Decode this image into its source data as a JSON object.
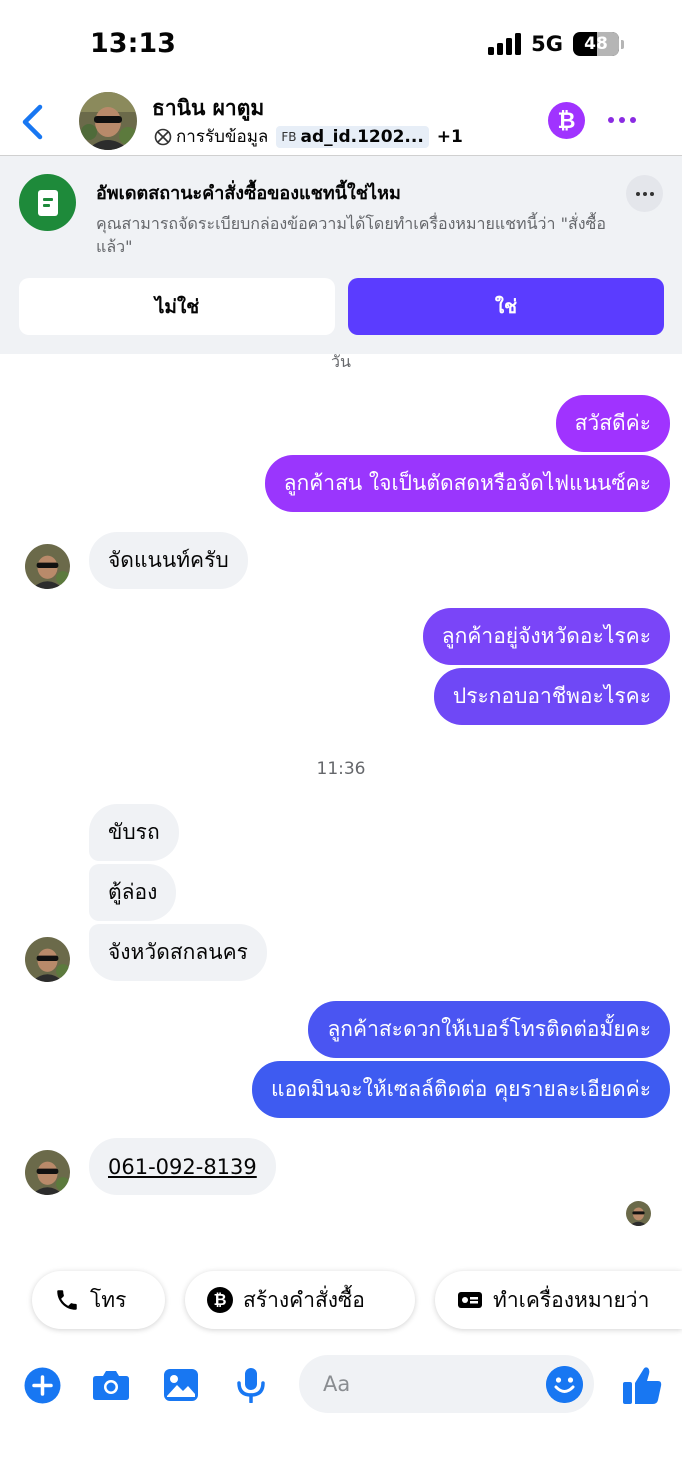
{
  "status_bar": {
    "time": "13:13",
    "network": "5G",
    "battery": "48"
  },
  "header": {
    "name": "ธานิน ผาตูม",
    "consent": "การรับข้อมูล",
    "ad_tag_prefix": "FB",
    "ad_tag": "ad_id.1202...",
    "extra_count": "+1",
    "bitcoin_glyph": "₿",
    "colors": {
      "accent": "#a033ff",
      "back": "#1877f2"
    }
  },
  "banner": {
    "title": "อัพเดตสถานะคำสั่งซื้อของแชทนี้ใช่ไหม",
    "description": "คุณสามารถจัดระเบียบกล่องข้อความได้โดยทำเครื่องหมายแชทนี้ว่า \"สั่งซื้อแล้ว\"",
    "no_label": "ไม่ใช่",
    "yes_label": "ใช่"
  },
  "chat": {
    "cut_divider": "วัน",
    "time_divider": "11:36",
    "messages": [
      {
        "dir": "out",
        "text": "สวัสดีค่ะ"
      },
      {
        "dir": "out",
        "text": "ลูกค้าสน ใจเป็นตัดสดหรือจัดไฟแนนซ์คะ"
      },
      {
        "dir": "in",
        "text": "จัดแนนท์ครับ"
      },
      {
        "dir": "out",
        "text": "ลูกค้าอยู่จังหวัดอะไรคะ"
      },
      {
        "dir": "out",
        "text": "ประกอบอาชีพอะไรคะ"
      },
      {
        "dir": "in",
        "text": "ขับรถ"
      },
      {
        "dir": "in",
        "text": "ตู้ล่อง"
      },
      {
        "dir": "in",
        "text": "จังหวัดสกลนคร"
      },
      {
        "dir": "out",
        "text": "ลูกค้าสะดวกให้เบอร์โทรติดต่อมั้ยคะ"
      },
      {
        "dir": "out",
        "text": "แอดมินจะให้เซลล์ติดต่อ คุยรายละเอียดค่ะ"
      },
      {
        "dir": "in",
        "text": "061-092-8139"
      }
    ],
    "bubble_colors": [
      "#a033ff",
      "#9a36fd",
      "#7a45f8",
      "#6f48f6",
      "#7045f7",
      "#4a55f2",
      "#3e5bf1"
    ]
  },
  "quick_actions": [
    {
      "icon": "phone-icon",
      "label": "โทร"
    },
    {
      "icon": "bitcoin-icon",
      "label": "สร้างคำสั่งซื้อ"
    },
    {
      "icon": "tag-icon",
      "label": "ทำเครื่องหมายว่า"
    }
  ],
  "composer": {
    "placeholder": "Aa"
  }
}
